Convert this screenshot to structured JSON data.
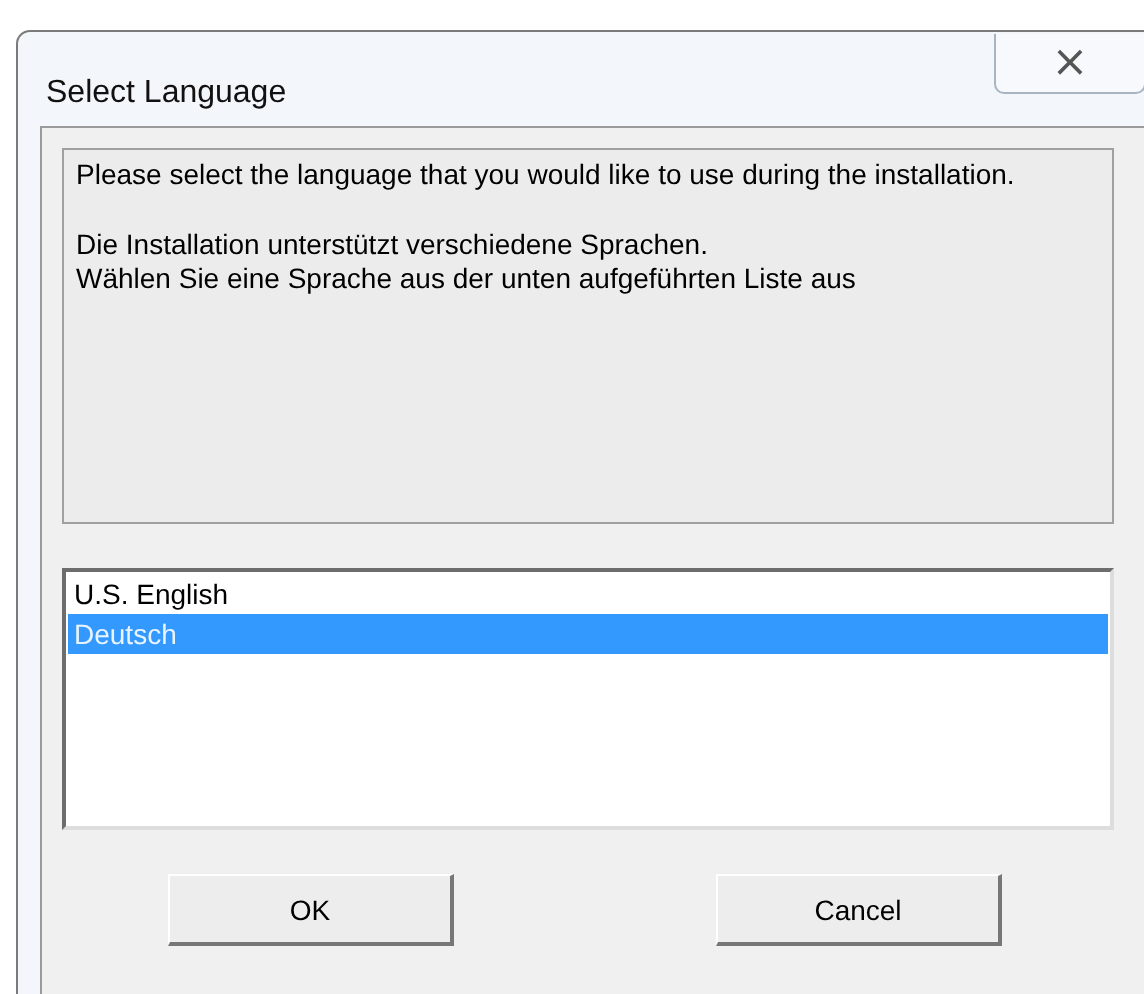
{
  "window": {
    "title": "Select Language",
    "close": "×"
  },
  "message": [
    "Please select the language that you would like to use during the installation.",
    "Die Installation unterstützt verschiedene Sprachen.\nWählen Sie eine Sprache aus der unten aufgeführten Liste aus"
  ],
  "languages": [
    {
      "label": "U.S. English",
      "selected": false
    },
    {
      "label": "Deutsch",
      "selected": true
    }
  ],
  "buttons": [
    {
      "label": "OK"
    },
    {
      "label": "Cancel"
    }
  ]
}
